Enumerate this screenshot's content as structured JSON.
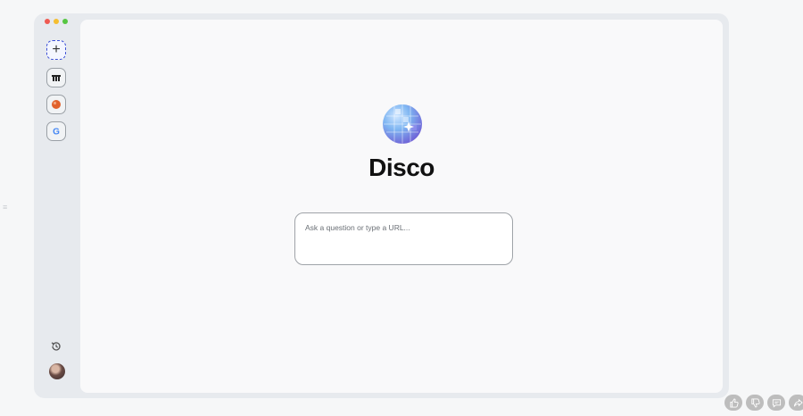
{
  "app": {
    "brand_name": "Disco"
  },
  "sidebar": {
    "new_tab_label": "+",
    "tabs": [
      {
        "icon": "bar-chart-favicon-icon"
      },
      {
        "icon": "orange-favicon-icon"
      },
      {
        "icon": "google-favicon-icon",
        "glyph": "G"
      }
    ]
  },
  "main": {
    "ask_placeholder": "Ask a question or type a URL..."
  },
  "colors": {
    "accent": "#3b4fd6",
    "window_frame": "#e7eaee",
    "content_bg": "#f9f9fa"
  }
}
